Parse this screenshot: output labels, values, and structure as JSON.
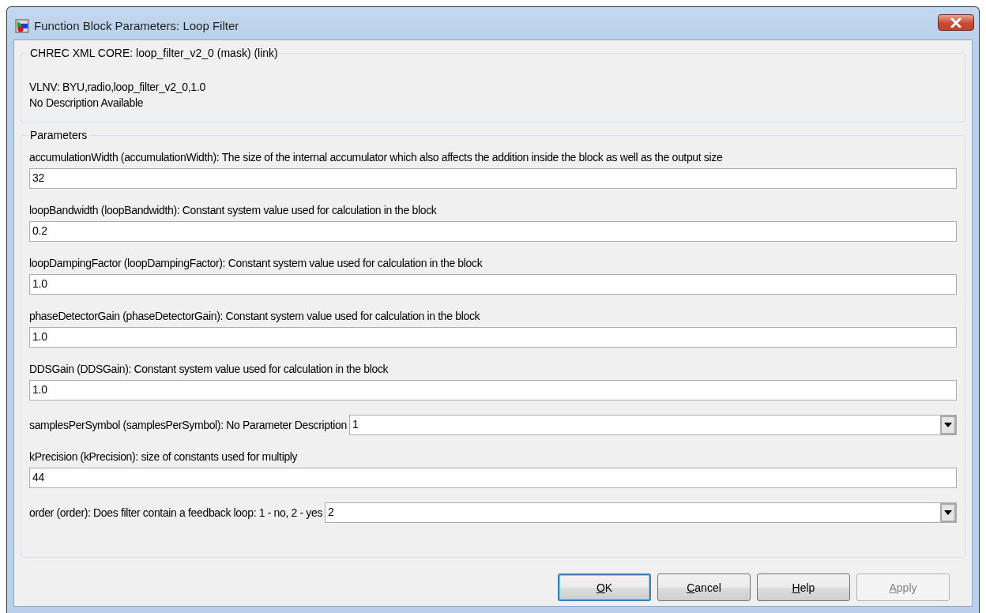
{
  "window": {
    "title": "Function Block Parameters: Loop Filter"
  },
  "description_group": {
    "title": "CHREC XML CORE: loop_filter_v2_0 (mask) (link)",
    "lines": [
      "VLNV: BYU,radio,loop_filter_v2_0,1.0",
      "No Description Available"
    ]
  },
  "parameters_group": {
    "title": "Parameters",
    "params": [
      {
        "kind": "edit",
        "label": "accumulationWidth (accumulationWidth): The size of the internal accumulator which also affects the addition inside the block as well as the output size",
        "value": "32"
      },
      {
        "kind": "edit",
        "label": "loopBandwidth (loopBandwidth): Constant system value used for calculation in the block",
        "value": "0.2"
      },
      {
        "kind": "edit",
        "label": "loopDampingFactor (loopDampingFactor): Constant system value used for calculation in the block",
        "value": "1.0"
      },
      {
        "kind": "edit",
        "label": "phaseDetectorGain (phaseDetectorGain): Constant system value used for calculation in the block",
        "value": "1.0"
      },
      {
        "kind": "edit",
        "label": "DDSGain (DDSGain): Constant system value used for calculation in the block",
        "value": "1.0"
      },
      {
        "kind": "popup",
        "label": "samplesPerSymbol (samplesPerSymbol): No Parameter Description",
        "value": "1"
      },
      {
        "kind": "edit",
        "label": "kPrecision (kPrecision): size of constants used for multiply",
        "value": "44"
      },
      {
        "kind": "popup",
        "label": "order (order): Does filter contain a feedback loop: 1 - no, 2 - yes",
        "value": "2"
      }
    ]
  },
  "buttons": [
    {
      "label": "OK",
      "underline_first": true,
      "default": true,
      "disabled": false
    },
    {
      "label": "Cancel",
      "underline_first": true,
      "default": false,
      "disabled": false
    },
    {
      "label": "Help",
      "underline_first": true,
      "default": false,
      "disabled": false
    },
    {
      "label": "Apply",
      "underline_first": true,
      "default": false,
      "disabled": true
    }
  ]
}
